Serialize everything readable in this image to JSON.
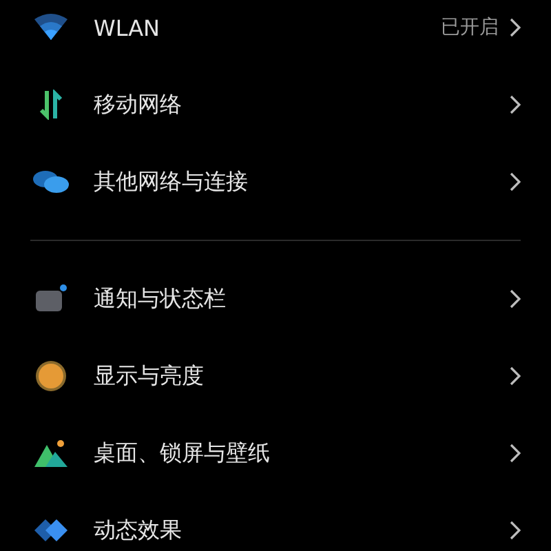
{
  "groups": [
    {
      "items": [
        {
          "kind": "wifi",
          "label": "WLAN",
          "value": "已开启"
        },
        {
          "kind": "arrows",
          "label": "移动网络"
        },
        {
          "kind": "bubbles",
          "label": "其他网络与连接"
        }
      ]
    },
    {
      "items": [
        {
          "kind": "notice",
          "label": "通知与状态栏"
        },
        {
          "kind": "sun",
          "label": "显示与亮度"
        },
        {
          "kind": "mountain",
          "label": "桌面、锁屏与壁纸"
        },
        {
          "kind": "layers",
          "label": "动态效果"
        }
      ]
    }
  ]
}
